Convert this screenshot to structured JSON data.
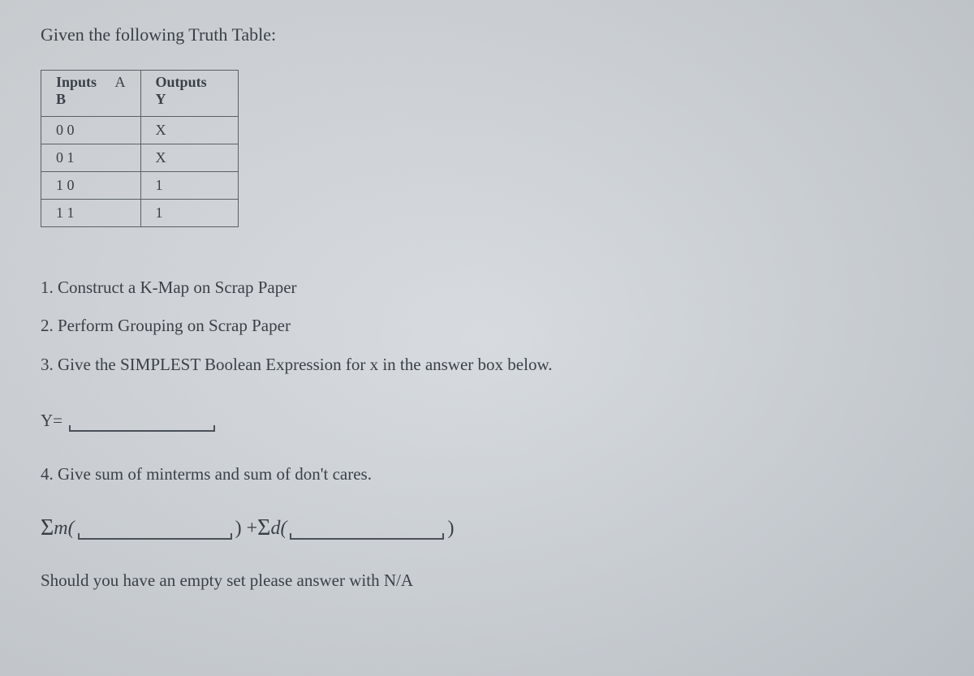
{
  "title": "Given the following Truth Table:",
  "table": {
    "headers": {
      "inputs_label": "Inputs",
      "inputs_col1": "A",
      "inputs_col2": "B",
      "outputs_label": "Outputs",
      "outputs_col": "Y"
    },
    "rows": [
      {
        "input": "0 0",
        "output": "X"
      },
      {
        "input": "0 1",
        "output": "X"
      },
      {
        "input": "1 0",
        "output": "1"
      },
      {
        "input": "1 1",
        "output": "1"
      }
    ]
  },
  "instructions": {
    "step1": "1. Construct a K-Map on Scrap Paper",
    "step2": "2. Perform Grouping on Scrap Paper",
    "step3": "3. Give the SIMPLEST Boolean Expression for x in the answer box below."
  },
  "answer_y_label": "Y=",
  "question4": "4. Give sum of minterms and sum of don't cares.",
  "formula": {
    "sigma1": "Σ",
    "m_label": "m(",
    "close_plus": ") + ",
    "sigma2": "Σ",
    "d_label": "d(",
    "close2": ")"
  },
  "note": "Should you have an empty set please answer with N/A"
}
